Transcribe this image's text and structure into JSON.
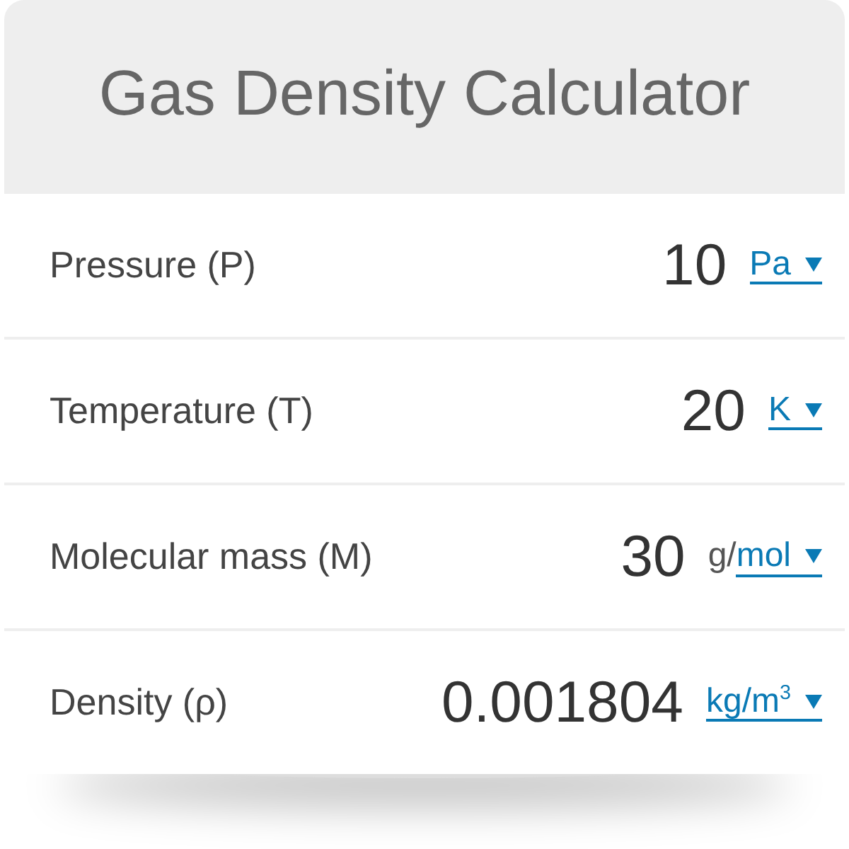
{
  "title": "Gas Density Calculator",
  "rows": [
    {
      "label": "Pressure (P)",
      "value": "10",
      "unit": {
        "link": "Pa"
      }
    },
    {
      "label": "Temperature (T)",
      "value": "20",
      "unit": {
        "link": "K"
      }
    },
    {
      "label": "Molecular mass (M)",
      "value": "30",
      "unit": {
        "prefix": "g/",
        "link": "mol"
      }
    },
    {
      "label": "Density (ρ)",
      "value": "0.001804",
      "unit": {
        "link": "kg/m$^{3}$"
      }
    }
  ]
}
